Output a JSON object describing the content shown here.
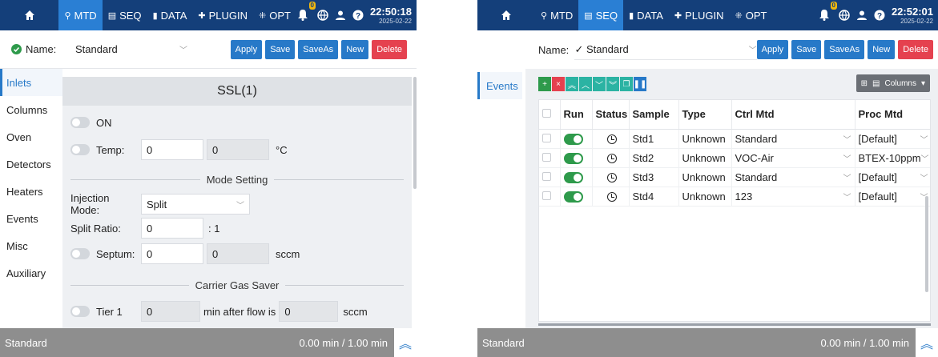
{
  "left": {
    "nav": {
      "tabs": [
        {
          "icon": "pin-icon",
          "label": "MTD",
          "active": true
        },
        {
          "icon": "list-icon",
          "label": "SEQ",
          "active": false
        },
        {
          "icon": "bar-chart-icon",
          "label": "DATA",
          "active": false
        },
        {
          "icon": "puzzle-icon",
          "label": "PLUGIN",
          "active": false
        },
        {
          "icon": "grid-icon",
          "label": "OPT",
          "active": false
        }
      ],
      "badge": "0",
      "time": "22:50:18",
      "date": "2025-02-22"
    },
    "namebar": {
      "label": "Name:",
      "value": "Standard",
      "buttons": [
        "Apply",
        "Save",
        "SaveAs",
        "New",
        "Delete"
      ]
    },
    "sidenav": [
      "Inlets",
      "Columns",
      "Oven",
      "Detectors",
      "Heaters",
      "Events",
      "Misc",
      "Auxiliary"
    ],
    "panel": {
      "title": "SSL(1)",
      "on_label": "ON",
      "temp_label": "Temp:",
      "temp_set": "0",
      "temp_actual": "0",
      "temp_unit": "°C",
      "mode_section": "Mode Setting",
      "injection_label": "Injection Mode:",
      "injection_value": "Split",
      "split_label": "Split Ratio:",
      "split_value": "0",
      "split_suffix": ": 1",
      "septum_label": "Septum:",
      "septum_set": "0",
      "septum_actual": "0",
      "septum_unit": "sccm",
      "saver_section": "Carrier Gas Saver",
      "tier1_label": "Tier 1",
      "tier1_time": "0",
      "tier1_mid": "min after flow is",
      "tier1_flow": "0",
      "tier1_unit": "sccm"
    },
    "status": {
      "method": "Standard",
      "time": "0.00 min / 1.00 min"
    }
  },
  "right": {
    "nav": {
      "tabs": [
        {
          "icon": "pin-icon",
          "label": "MTD",
          "active": false
        },
        {
          "icon": "list-icon",
          "label": "SEQ",
          "active": true
        },
        {
          "icon": "bar-chart-icon",
          "label": "DATA",
          "active": false
        },
        {
          "icon": "puzzle-icon",
          "label": "PLUGIN",
          "active": false
        },
        {
          "icon": "grid-icon",
          "label": "OPT",
          "active": false
        }
      ],
      "badge": "0",
      "time": "22:52:01",
      "date": "2025-02-22"
    },
    "namebar": {
      "label": "Name:",
      "value": "✓ Standard",
      "buttons": [
        "Apply",
        "Save",
        "SaveAs",
        "New",
        "Delete"
      ]
    },
    "tab": "Events",
    "columns_button": "Columns",
    "table": {
      "headers": [
        "",
        "Run",
        "Status",
        "Sample",
        "Type",
        "Ctrl Mtd",
        "Proc Mtd"
      ],
      "rows": [
        {
          "sample": "Std1",
          "type": "Unknown",
          "ctrl": "Standard",
          "proc": "[Default]"
        },
        {
          "sample": "Std2",
          "type": "Unknown",
          "ctrl": "VOC-Air",
          "proc": "BTEX-10ppm"
        },
        {
          "sample": "Std3",
          "type": "Unknown",
          "ctrl": "Standard",
          "proc": "[Default]"
        },
        {
          "sample": "Std4",
          "type": "Unknown",
          "ctrl": "123",
          "proc": "[Default]"
        }
      ]
    },
    "status": {
      "method": "Standard",
      "time": "0.00 min / 1.00 min"
    }
  },
  "colors": {
    "nav": "#143f7a",
    "accent": "#2779c8",
    "danger": "#e5414f",
    "toggle_on": "#2e9a4b",
    "status_bar": "#8e8e8e"
  }
}
